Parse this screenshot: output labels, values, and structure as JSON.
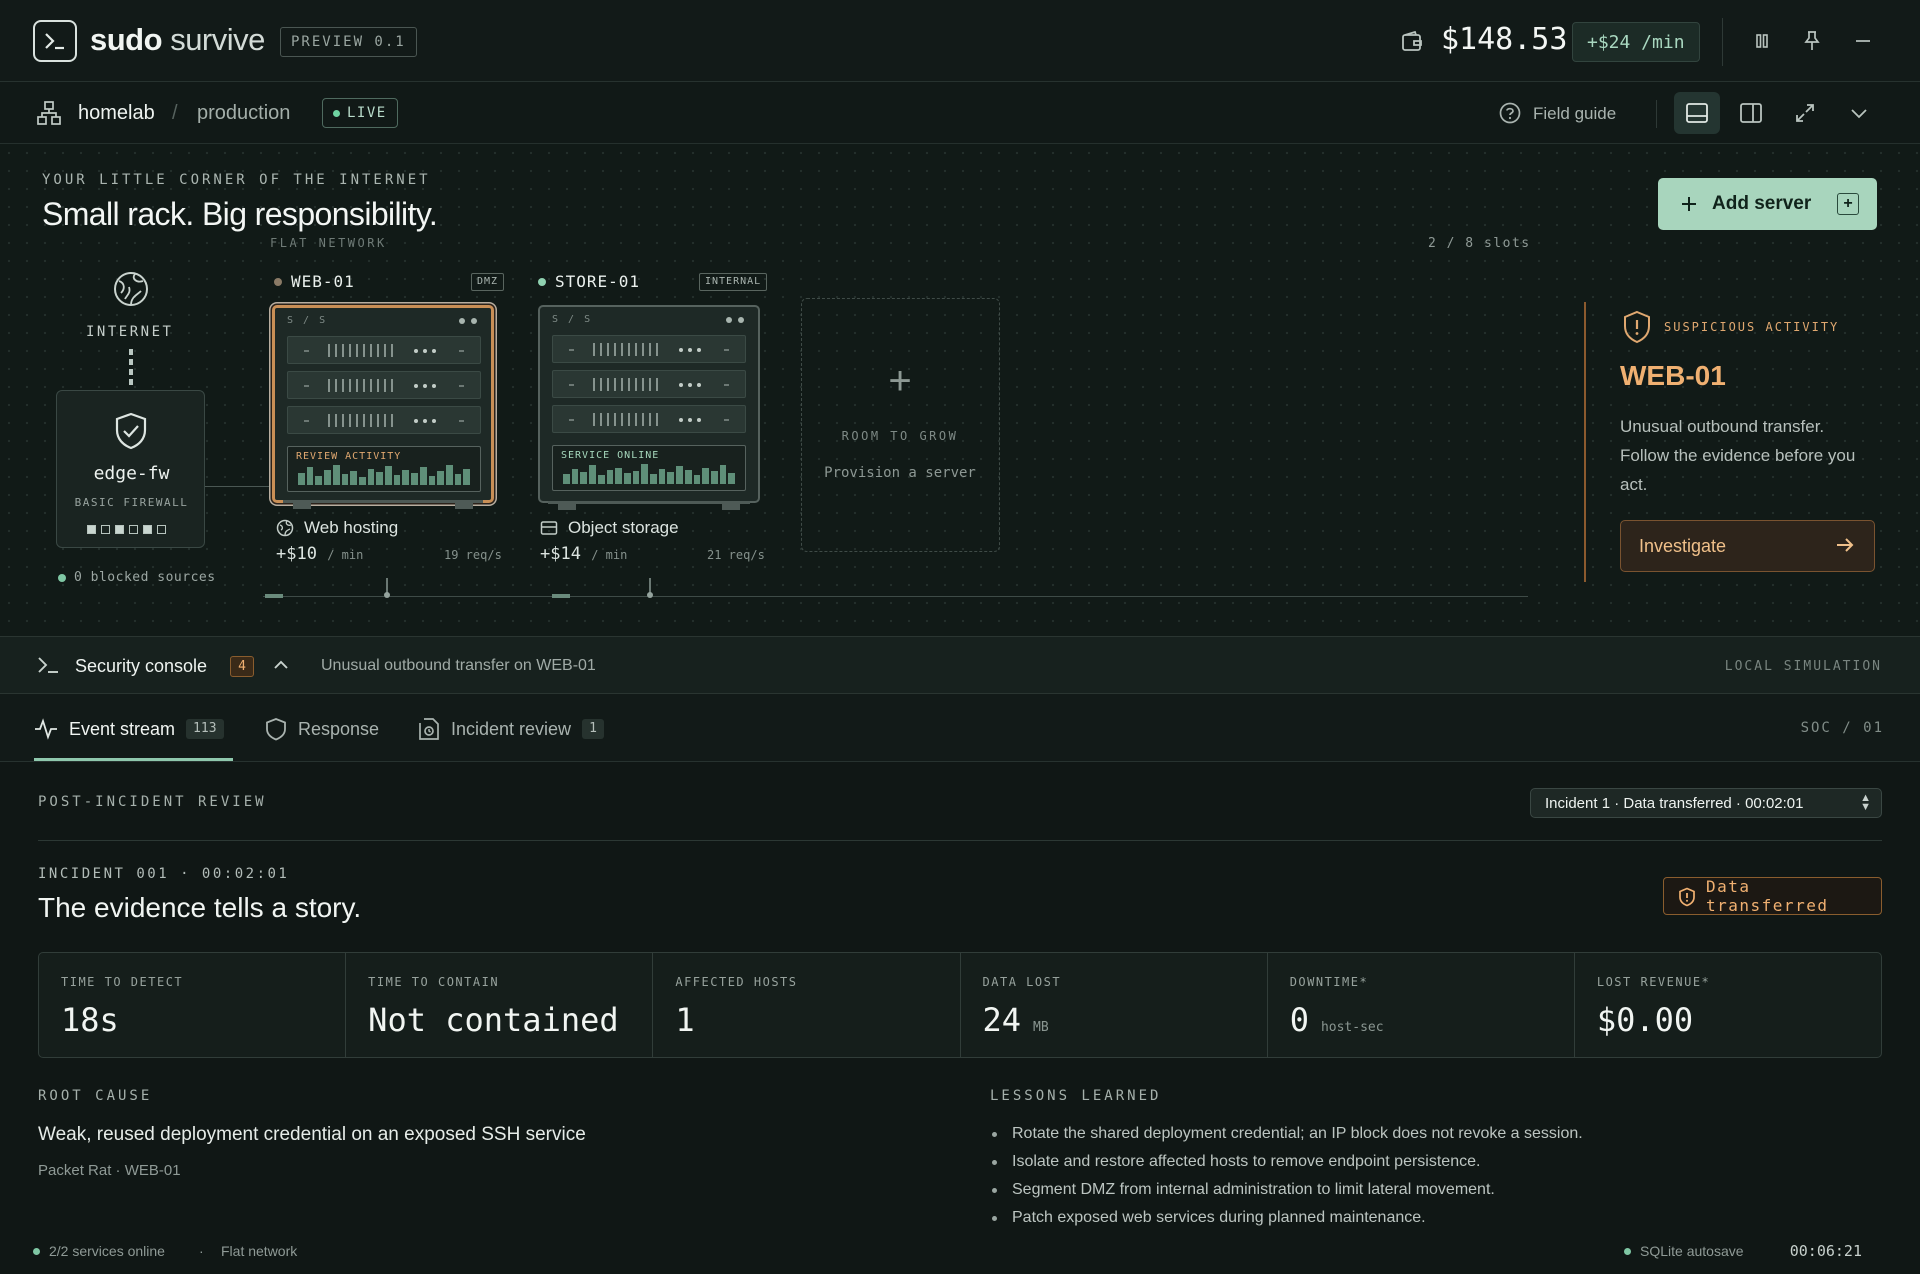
{
  "app": {
    "brand_bold": "sudo",
    "brand_light": "survive",
    "version_tag": "PREVIEW 0.1",
    "balance": "$148.53",
    "rate": "+$24 /min"
  },
  "breadcrumb": {
    "root": "homelab",
    "separator": "/",
    "current": "production",
    "status": "LIVE",
    "field_guide": "Field guide"
  },
  "scene": {
    "eyebrow": "YOUR LITTLE CORNER OF THE INTERNET",
    "headline": "Small rack. Big responsibility.",
    "network_label": "FLAT NETWORK",
    "slots": "2 / 8 slots",
    "add_server_label": "Add server",
    "add_server_kbd": "+",
    "internet_label": "INTERNET",
    "firewall": {
      "name": "edge-fw",
      "type": "BASIC FIREWALL",
      "blocked": "0 blocked sources"
    },
    "servers": [
      {
        "name": "WEB-01",
        "zone": "DMZ",
        "rack_label": "S / S",
        "activity_label": "REVIEW ACTIVITY",
        "service": "Web hosting",
        "earn": "+$10",
        "earn_unit": "/ min",
        "reqs": "19 req/s",
        "status_color": "#8a7a66",
        "accent": "#e0a870"
      },
      {
        "name": "STORE-01",
        "zone": "INTERNAL",
        "rack_label": "S / S",
        "activity_label": "SERVICE ONLINE",
        "service": "Object storage",
        "earn": "+$14",
        "earn_unit": "/ min",
        "reqs": "21 req/s",
        "status_color": "#8fd1b0",
        "accent": "#a6d8bd"
      }
    ],
    "grow": {
      "plus": "+",
      "title": "ROOM TO GROW",
      "subtitle": "Provision a server"
    },
    "alert": {
      "tag": "SUSPICIOUS ACTIVITY",
      "title": "WEB-01",
      "body": "Unusual outbound transfer. Follow the evidence before you act.",
      "button": "Investigate"
    }
  },
  "console": {
    "title": "Security console",
    "badge": "4",
    "message": "Unusual outbound transfer on WEB-01",
    "mode": "LOCAL SIMULATION"
  },
  "tabs": [
    {
      "label": "Event stream",
      "count": "113"
    },
    {
      "label": "Response",
      "count": ""
    },
    {
      "label": "Incident review",
      "count": "1"
    }
  ],
  "soc_label": "SOC / 01",
  "review": {
    "eyebrow": "POST-INCIDENT REVIEW",
    "selector": "Incident 1 · Data transferred · 00:02:01",
    "incident_id": "INCIDENT 001 · 00:02:01",
    "title": "The evidence tells a story.",
    "badge": "Data transferred",
    "metrics": [
      {
        "label": "TIME TO DETECT",
        "value": "18s",
        "unit": ""
      },
      {
        "label": "TIME TO CONTAIN",
        "value": "Not contained",
        "unit": ""
      },
      {
        "label": "AFFECTED HOSTS",
        "value": "1",
        "unit": ""
      },
      {
        "label": "DATA LOST",
        "value": "24",
        "unit": "MB"
      },
      {
        "label": "DOWNTIME*",
        "value": "0",
        "unit": "host-sec"
      },
      {
        "label": "LOST REVENUE*",
        "value": "$0.00",
        "unit": ""
      }
    ],
    "root_cause_label": "ROOT CAUSE",
    "root_cause": "Weak, reused deployment credential on an exposed SSH service",
    "root_cause_sub": "Packet Rat · WEB-01",
    "lessons_label": "LESSONS LEARNED",
    "lessons": [
      "Rotate the shared deployment credential; an IP block does not revoke a session.",
      "Isolate and restore affected hosts to remove endpoint persistence.",
      "Segment DMZ from internal administration to limit lateral movement.",
      "Patch exposed web services during planned maintenance."
    ]
  },
  "status": {
    "services": "2/2 services online",
    "sep": "·",
    "network": "Flat network",
    "autosave": "SQLite autosave",
    "clock": "00:06:21"
  }
}
